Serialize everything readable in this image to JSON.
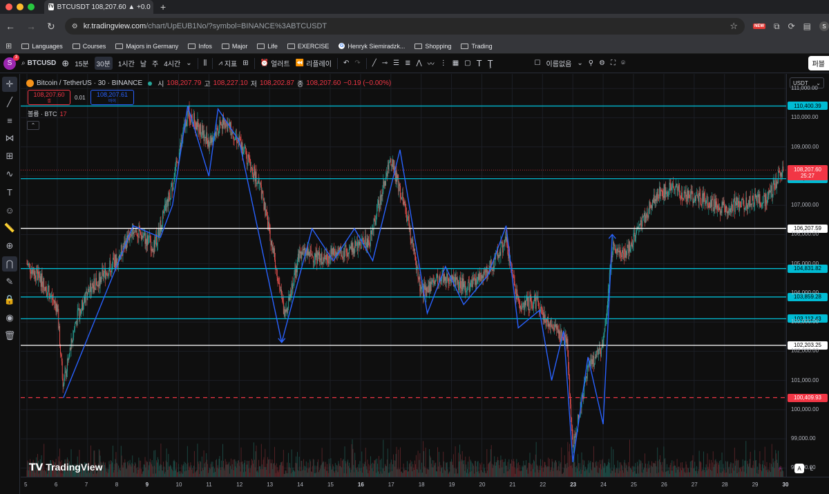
{
  "browser": {
    "tab_title": "BTCUSDT 108,207.60 ▲ +0.0",
    "url_domain": "kr.tradingview.com",
    "url_path": "/chart/UpEUB1No/?symbol=BINANCE%3ABTCUSDT",
    "new_badge": "NEW",
    "profile_initial": "S",
    "bookmarks": [
      "Languages",
      "Courses",
      "Majors in Germany",
      "Infos",
      "Major",
      "Life",
      "EXERCISE",
      "Henryk Siemiradzk...",
      "Shopping",
      "Trading"
    ]
  },
  "toolbar": {
    "avatar_initial": "S",
    "avatar_badge": "3",
    "symbol": "BTCUSD",
    "timeframes": [
      "15분",
      "30분",
      "1시간",
      "날",
      "주",
      "4시간"
    ],
    "active_timeframe": "30분",
    "indicators_label": "지표",
    "alert_label": "얼러트",
    "replay_label": "리플레이",
    "layout_name": "이름없음",
    "publish_label": "퍼블"
  },
  "legend": {
    "title": "Bitcoin / TetherUS · 30 · BINANCE",
    "o_label": "시",
    "o_value": "108,207.79",
    "h_label": "고",
    "h_value": "108,227.10",
    "l_label": "저",
    "l_value": "108,202.87",
    "c_label": "종",
    "c_value": "108,207.60",
    "change": "−0.19 (−0.00%)",
    "sell_price": "108,207.60",
    "sell_label": "셀",
    "buy_price": "108,207.61",
    "buy_label": "바이",
    "spread": "0.01",
    "volume_label": "볼륨 · BTC",
    "volume_value": "17"
  },
  "price_axis": {
    "currency": "USDT",
    "ticks": [
      "111,000.00",
      "110,000.00",
      "109,000.00",
      "108,000.00",
      "107,000.00",
      "106,000.00",
      "105,000.00",
      "104,000.00",
      "103,000.00",
      "102,000.00",
      "101,000.00",
      "100,000.00",
      "99,000.00",
      "98,000.00"
    ],
    "current_price": "108,207.60",
    "countdown": "25:27",
    "levels": [
      {
        "price": 110400.39,
        "label": "110,400.39",
        "color": "#00bcd4",
        "style": "solid"
      },
      {
        "price": 107911.38,
        "label": "107,911.38",
        "color": "#00bcd4",
        "style": "solid"
      },
      {
        "price": 106207.59,
        "label": "106,207.59",
        "color": "#ffffff",
        "style": "solid"
      },
      {
        "price": 104831.82,
        "label": "104,831.82",
        "color": "#00bcd4",
        "style": "solid"
      },
      {
        "price": 103859.28,
        "label": "103,859.28",
        "color": "#00bcd4",
        "style": "solid"
      },
      {
        "price": 103112.43,
        "label": "103,112.43",
        "color": "#00bcd4",
        "style": "solid"
      },
      {
        "price": 102203.25,
        "label": "102,203.25",
        "color": "#ffffff",
        "style": "solid"
      },
      {
        "price": 100409.93,
        "label": "100,409.93",
        "color": "#f23645",
        "style": "dashed"
      }
    ]
  },
  "time_axis": {
    "ticks": [
      {
        "label": "5",
        "bold": false
      },
      {
        "label": "6",
        "bold": false
      },
      {
        "label": "7",
        "bold": false
      },
      {
        "label": "8",
        "bold": false
      },
      {
        "label": "9",
        "bold": true
      },
      {
        "label": "10",
        "bold": false
      },
      {
        "label": "11",
        "bold": false
      },
      {
        "label": "12",
        "bold": false
      },
      {
        "label": "13",
        "bold": false
      },
      {
        "label": "14",
        "bold": false
      },
      {
        "label": "15",
        "bold": false
      },
      {
        "label": "16",
        "bold": true
      },
      {
        "label": "17",
        "bold": false
      },
      {
        "label": "18",
        "bold": false
      },
      {
        "label": "19",
        "bold": false
      },
      {
        "label": "20",
        "bold": false
      },
      {
        "label": "21",
        "bold": false
      },
      {
        "label": "22",
        "bold": false
      },
      {
        "label": "23",
        "bold": true
      },
      {
        "label": "24",
        "bold": false
      },
      {
        "label": "25",
        "bold": false
      },
      {
        "label": "26",
        "bold": false
      },
      {
        "label": "27",
        "bold": false
      },
      {
        "label": "28",
        "bold": false
      },
      {
        "label": "29",
        "bold": false
      },
      {
        "label": "30",
        "bold": true
      }
    ]
  },
  "chart_data": {
    "type": "line",
    "title": "Bitcoin / TetherUS · 30 · BINANCE",
    "ylim": [
      97700,
      111500
    ],
    "zigzag_x_days": [
      6.2,
      8.5,
      9.4,
      9.8,
      10.3,
      11.0,
      11.3,
      12.0,
      13.4,
      14.4,
      15.1,
      15.8,
      16.4,
      17.3,
      18.2,
      18.8,
      19.4,
      20.2,
      20.8,
      21.2,
      21.9,
      22.3,
      22.7,
      23.0,
      23.5,
      24.0,
      24.3
    ],
    "zigzag_prices": [
      100400,
      106300,
      105900,
      107000,
      110400,
      108000,
      110300,
      109200,
      102300,
      106200,
      105100,
      106200,
      105100,
      108900,
      103300,
      104900,
      103600,
      104600,
      106300,
      102800,
      103400,
      101000,
      102700,
      98200,
      101800,
      99500,
      106000
    ],
    "candles_approx": [
      {
        "day": 5.0,
        "price": 105000
      },
      {
        "day": 5.5,
        "price": 104400
      },
      {
        "day": 6.0,
        "price": 103500
      },
      {
        "day": 6.2,
        "price": 100800
      },
      {
        "day": 6.6,
        "price": 103000
      },
      {
        "day": 7.0,
        "price": 104000
      },
      {
        "day": 8.0,
        "price": 105200
      },
      {
        "day": 8.5,
        "price": 106200
      },
      {
        "day": 9.2,
        "price": 105600
      },
      {
        "day": 9.8,
        "price": 107700
      },
      {
        "day": 10.3,
        "price": 110200
      },
      {
        "day": 11.0,
        "price": 109200
      },
      {
        "day": 11.5,
        "price": 109900
      },
      {
        "day": 12.0,
        "price": 109200
      },
      {
        "day": 12.7,
        "price": 107600
      },
      {
        "day": 13.2,
        "price": 105000
      },
      {
        "day": 13.5,
        "price": 103200
      },
      {
        "day": 14.0,
        "price": 105400
      },
      {
        "day": 14.7,
        "price": 105200
      },
      {
        "day": 15.5,
        "price": 105400
      },
      {
        "day": 16.3,
        "price": 105800
      },
      {
        "day": 17.0,
        "price": 108600
      },
      {
        "day": 17.5,
        "price": 106800
      },
      {
        "day": 18.0,
        "price": 104000
      },
      {
        "day": 18.7,
        "price": 104600
      },
      {
        "day": 19.5,
        "price": 104200
      },
      {
        "day": 20.3,
        "price": 104900
      },
      {
        "day": 20.8,
        "price": 105800
      },
      {
        "day": 21.2,
        "price": 103600
      },
      {
        "day": 21.8,
        "price": 103700
      },
      {
        "day": 22.3,
        "price": 102800
      },
      {
        "day": 22.8,
        "price": 102400
      },
      {
        "day": 23.0,
        "price": 98800
      },
      {
        "day": 23.5,
        "price": 101400
      },
      {
        "day": 24.0,
        "price": 102200
      },
      {
        "day": 24.3,
        "price": 105500
      },
      {
        "day": 24.8,
        "price": 105400
      },
      {
        "day": 25.3,
        "price": 106500
      },
      {
        "day": 25.8,
        "price": 107400
      },
      {
        "day": 26.3,
        "price": 107600
      },
      {
        "day": 26.8,
        "price": 107300
      },
      {
        "day": 27.3,
        "price": 107200
      },
      {
        "day": 27.8,
        "price": 106900
      },
      {
        "day": 28.3,
        "price": 107000
      },
      {
        "day": 28.8,
        "price": 107100
      },
      {
        "day": 29.4,
        "price": 107200
      },
      {
        "day": 29.9,
        "price": 108200
      }
    ],
    "colors": {
      "up": "#26a69a",
      "down": "#ef5350",
      "zigzag": "#2962ff",
      "current": "#f23645"
    }
  }
}
